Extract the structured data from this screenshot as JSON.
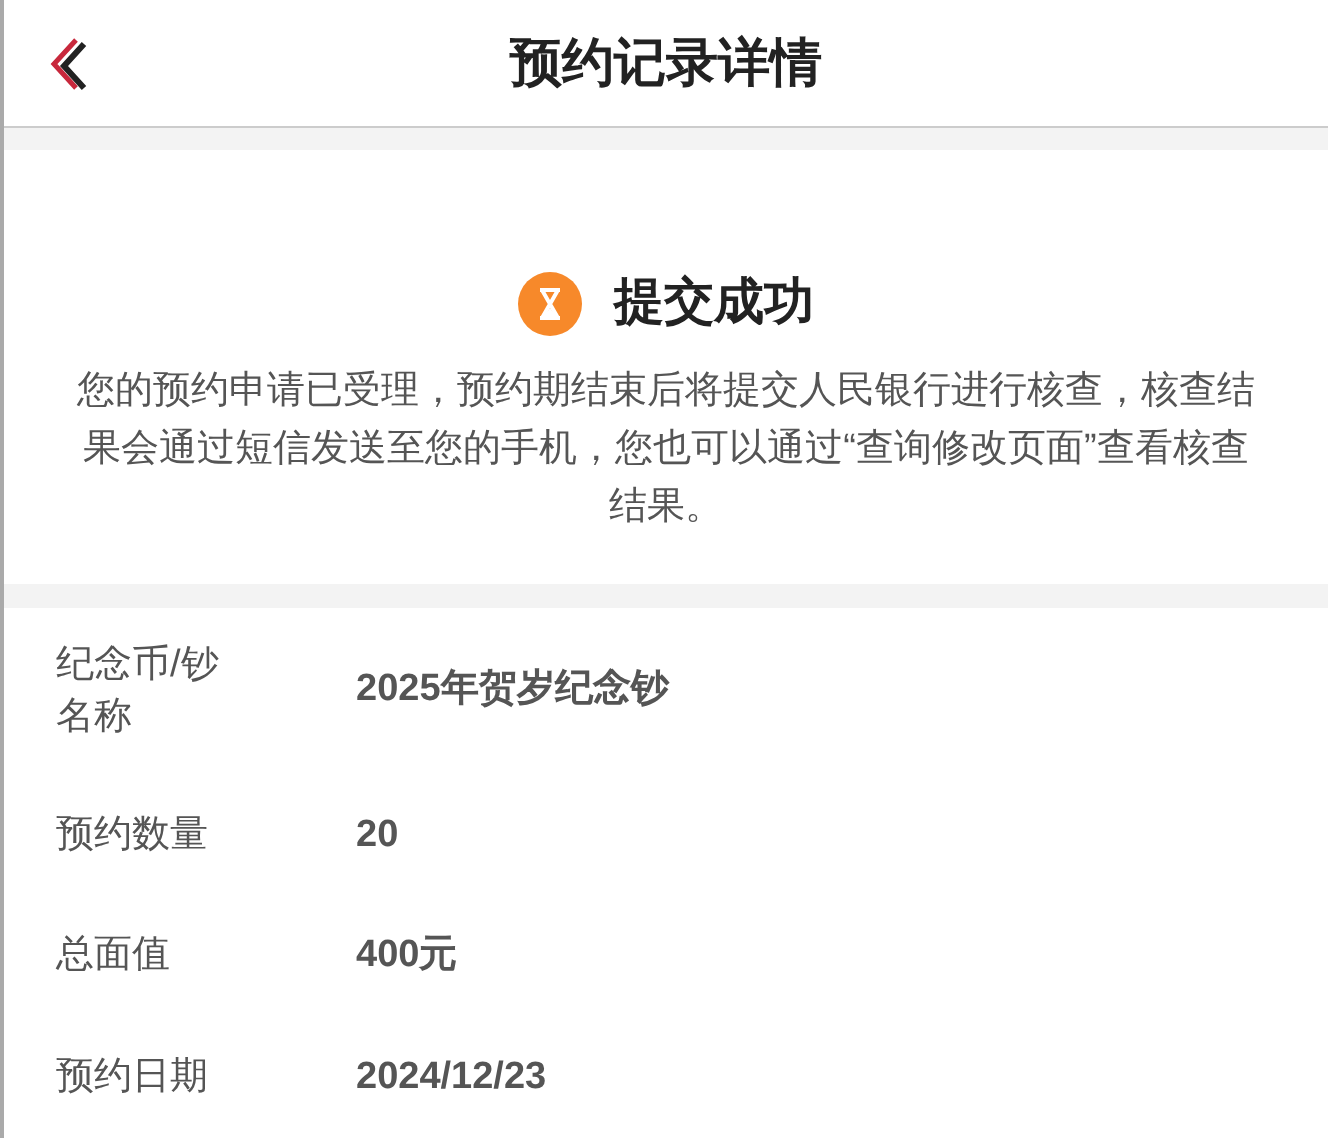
{
  "header": {
    "title": "预约记录详情"
  },
  "status": {
    "title": "提交成功",
    "message": "您的预约申请已受理，预约期结束后将提交人民银行进行核查，核查结果会通过短信发送至您的手机，您也可以通过“查询修改页面”查看核查结果。"
  },
  "details": [
    {
      "label": "纪念币/钞名称",
      "value": "2025年贺岁纪念钞"
    },
    {
      "label": "预约数量",
      "value": "20"
    },
    {
      "label": "总面值",
      "value": "400元"
    },
    {
      "label": "预约日期",
      "value": "2024/12/23"
    }
  ]
}
